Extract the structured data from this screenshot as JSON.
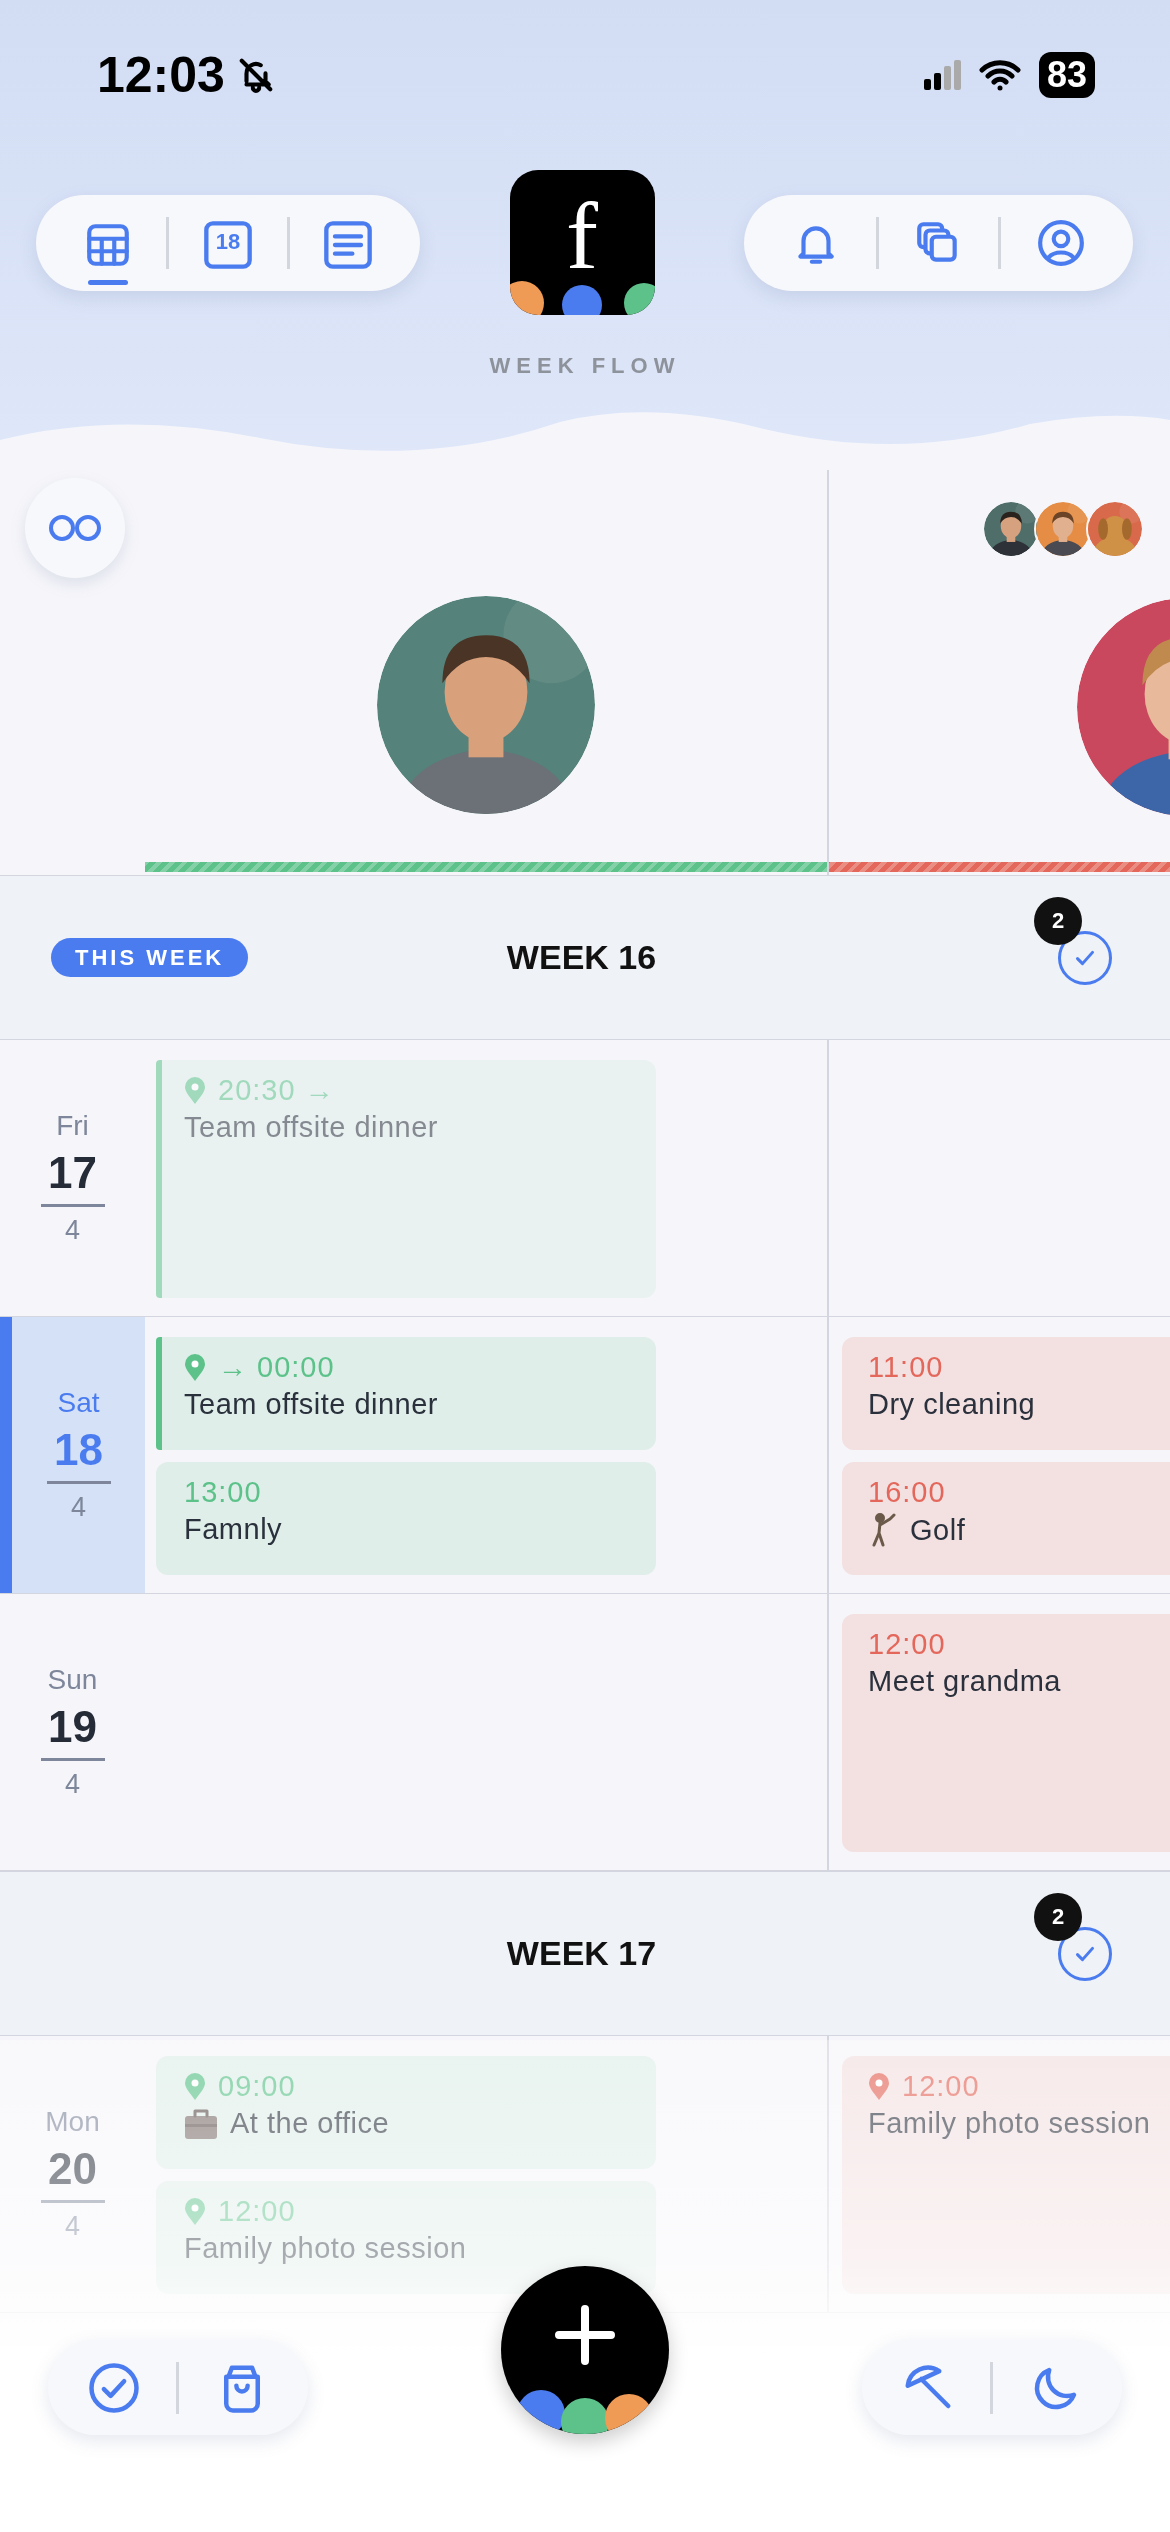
{
  "status_bar": {
    "time": "12:03",
    "silent": true,
    "battery": "83"
  },
  "nav_left": [
    {
      "selected": true
    },
    {
      "label": "18",
      "selected": false
    },
    {
      "selected": false
    }
  ],
  "logo": {
    "letter": "f"
  },
  "app_name": "WEEK FLOW",
  "people": [
    {
      "kind": "single",
      "color": "#5cc28a"
    },
    {
      "kind": "group",
      "color": "#e3675a"
    }
  ],
  "weeks": [
    {
      "title": "WEEK 16",
      "badge": "THIS WEEK",
      "pending": "2",
      "days": [
        {
          "weekday": "Fri",
          "day": "17",
          "month": "4",
          "today": false,
          "column_1": [
            {
              "kind": "plain",
              "time": "20:30 →",
              "title": "Team offsite dinner",
              "location": true,
              "continues": true,
              "past": true
            }
          ]
        },
        {
          "weekday": "Sat",
          "day": "18",
          "month": "4",
          "today": true,
          "column_1": [
            {
              "kind": "plain",
              "time": "→ 00:00",
              "title": "Team offsite dinner",
              "location": true,
              "continues": true,
              "past": false
            },
            {
              "kind": "plain",
              "time": "13:00",
              "title": "Famnly",
              "location": false,
              "continues": false,
              "past": false
            }
          ],
          "column_2": [
            {
              "kind": "plain",
              "time": "11:00",
              "title": "Dry cleaning",
              "location": false,
              "continues": false,
              "past": false
            },
            {
              "kind": "golf",
              "time": "16:00",
              "title": "Golf",
              "location": false,
              "continues": false,
              "past": false
            }
          ]
        },
        {
          "weekday": "Sun",
          "day": "19",
          "month": "4",
          "today": false,
          "column_2": [
            {
              "kind": "plain",
              "time": "12:00",
              "title": "Meet grandma",
              "location": false,
              "continues": false,
              "past": false
            }
          ]
        }
      ]
    },
    {
      "title": "WEEK 17",
      "pending": "2",
      "days": [
        {
          "weekday": "Mon",
          "day": "20",
          "month": "4",
          "today": false,
          "column_1": [
            {
              "kind": "work",
              "time": "09:00",
              "title": "At the office",
              "location": true,
              "continues": false,
              "past": false
            },
            {
              "kind": "plain",
              "time": "12:00",
              "title": "Family photo session",
              "location": true,
              "continues": false,
              "past": false
            }
          ],
          "column_2": [
            {
              "kind": "plain",
              "time": "12:00",
              "title": "Family photo session",
              "location": true,
              "continues": false,
              "past": false
            }
          ]
        }
      ]
    }
  ]
}
